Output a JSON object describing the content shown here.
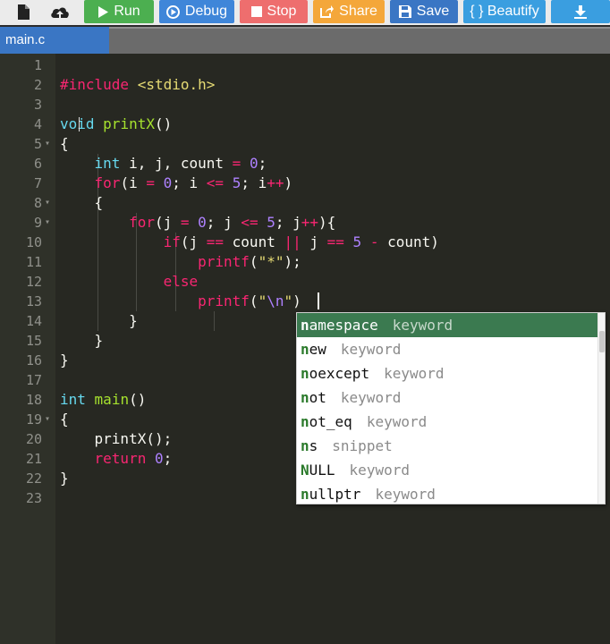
{
  "toolbar": {
    "run_label": "Run",
    "debug_label": "Debug",
    "stop_label": "Stop",
    "share_label": "Share",
    "save_label": "Save",
    "beautify_label": "{ } Beautify",
    "colors": {
      "run": "#4caf50",
      "debug": "#3f86d9",
      "stop": "#ee6e6e",
      "share": "#f4a73a",
      "save": "#3a76c4",
      "beautify": "#3a9ee0",
      "download": "#3a9ee0"
    }
  },
  "tabs": [
    {
      "label": "main.c"
    }
  ],
  "editor": {
    "line_numbers": [
      "1",
      "2",
      "3",
      "4",
      "5",
      "6",
      "7",
      "8",
      "9",
      "10",
      "11",
      "12",
      "13",
      "14",
      "15",
      "16",
      "17",
      "18",
      "19",
      "20",
      "21",
      "22",
      "23"
    ]
  },
  "autocomplete": {
    "typed_prefix": "n",
    "items": [
      {
        "rest": "amespace",
        "meta": "keyword"
      },
      {
        "rest": "ew",
        "meta": "keyword"
      },
      {
        "rest": "oexcept",
        "meta": "keyword"
      },
      {
        "rest": "ot",
        "meta": "keyword"
      },
      {
        "rest": "ot_eq",
        "meta": "keyword"
      },
      {
        "rest": "s",
        "meta": "snippet"
      },
      {
        "prefix_override": "N",
        "rest": "ULL",
        "meta": "keyword"
      },
      {
        "rest": "ullptr",
        "meta": "keyword"
      }
    ]
  }
}
